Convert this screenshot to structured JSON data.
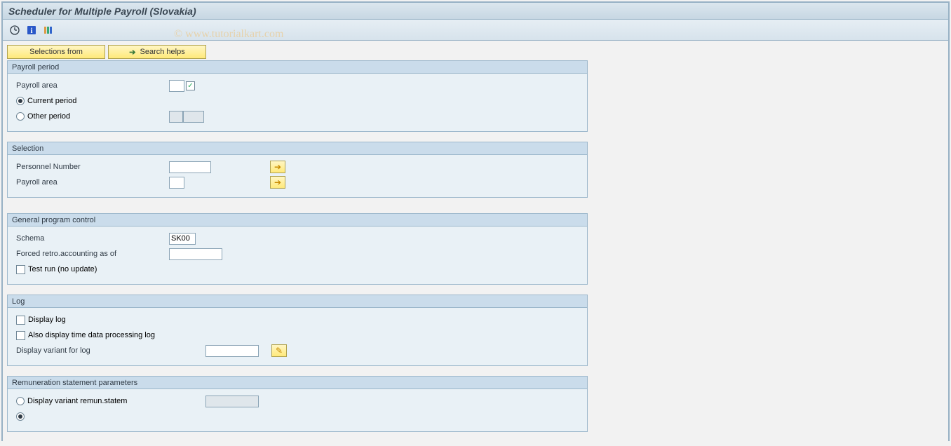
{
  "title": "Scheduler for Multiple Payroll (Slovakia)",
  "watermark": "© www.tutorialkart.com",
  "toolbar": {
    "execute_icon": "execute",
    "info_icon": "info",
    "variant_icon": "variant"
  },
  "buttons": {
    "selections_from": "Selections from",
    "search_helps": "Search helps"
  },
  "groups": {
    "payroll_period": {
      "title": "Payroll period",
      "payroll_area_label": "Payroll area",
      "payroll_area_checked": "✓",
      "current_period_label": "Current period",
      "other_period_label": "Other period"
    },
    "selection": {
      "title": "Selection",
      "personnel_number_label": "Personnel Number",
      "payroll_area_label": "Payroll area"
    },
    "general": {
      "title": "General program control",
      "schema_label": "Schema",
      "schema_value": "SK00",
      "forced_retro_label": "Forced retro.accounting as of",
      "test_run_label": "Test run (no update)"
    },
    "log": {
      "title": "Log",
      "display_log_label": "Display log",
      "also_display_label": "Also display time data processing log",
      "display_variant_label": "Display variant for log"
    },
    "remun": {
      "title": "Remuneration statement parameters",
      "display_variant_remun_label": "Display variant remun.statem"
    }
  }
}
